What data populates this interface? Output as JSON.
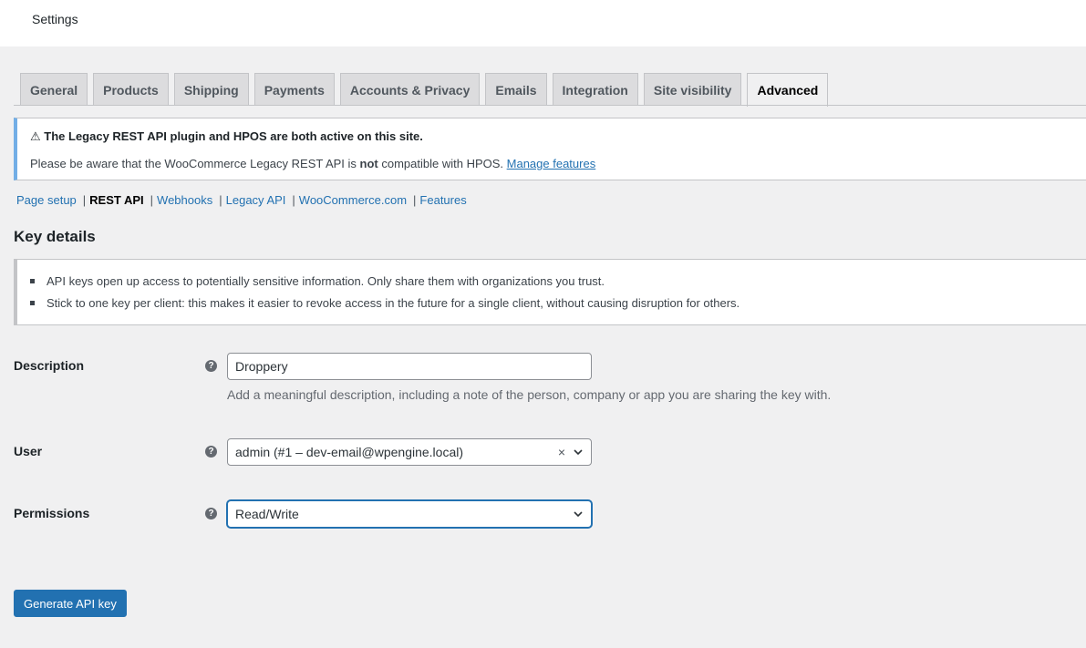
{
  "header": {
    "title": "Settings"
  },
  "tabs": [
    {
      "label": "General"
    },
    {
      "label": "Products"
    },
    {
      "label": "Shipping"
    },
    {
      "label": "Payments"
    },
    {
      "label": "Accounts & Privacy"
    },
    {
      "label": "Emails"
    },
    {
      "label": "Integration"
    },
    {
      "label": "Site visibility"
    },
    {
      "label": "Advanced",
      "active": true
    }
  ],
  "notice": {
    "icon": "warning-icon",
    "icon_glyph": "⚠",
    "title": "The Legacy REST API plugin and HPOS are both active on this site.",
    "body_before": "Please be aware that the WooCommerce Legacy REST API is ",
    "body_bold": "not",
    "body_after": " compatible with HPOS. ",
    "link": "Manage features"
  },
  "subnav": {
    "items": [
      {
        "label": "Page setup"
      },
      {
        "label": "REST API",
        "current": true
      },
      {
        "label": "Webhooks"
      },
      {
        "label": "Legacy API"
      },
      {
        "label": "WooCommerce.com"
      },
      {
        "label": "Features"
      }
    ],
    "separator": "|"
  },
  "section_title": "Key details",
  "info": {
    "items": [
      "API keys open up access to potentially sensitive information. Only share them with organizations you trust.",
      "Stick to one key per client: this makes it easier to revoke access in the future for a single client, without causing disruption for others."
    ]
  },
  "form": {
    "help_glyph": "?",
    "description": {
      "label": "Description",
      "value": "Droppery",
      "hint": "Add a meaningful description, including a note of the person, company or app you are sharing the key with."
    },
    "user": {
      "label": "User",
      "value": "admin (#1 – dev-email@wpengine.local)",
      "clear_glyph": "×"
    },
    "permissions": {
      "label": "Permissions",
      "value": "Read/Write"
    },
    "submit_label": "Generate API key"
  }
}
